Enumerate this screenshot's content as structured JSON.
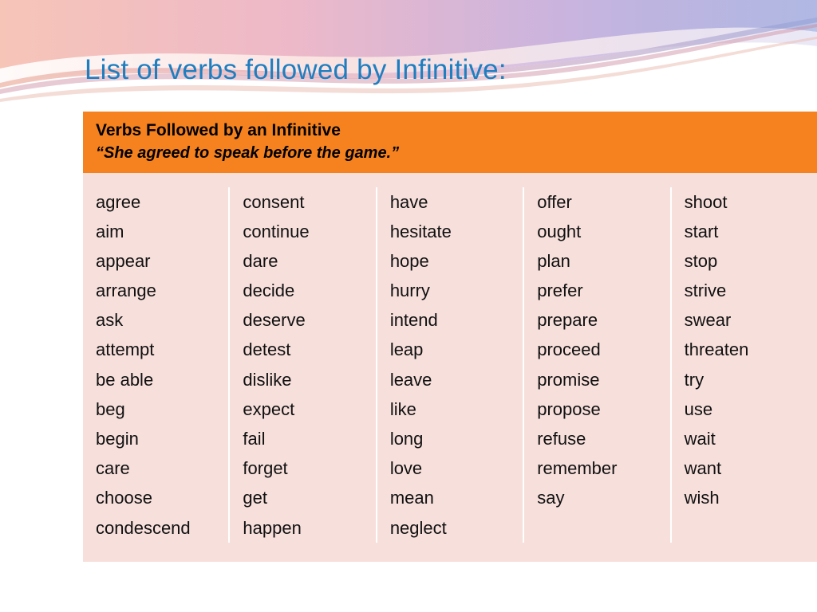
{
  "slide": {
    "title": "List of verbs followed by Infinitive:",
    "table": {
      "header_title": "Verbs Followed by an Infinitive",
      "header_example": "“She agreed to speak before the game.”",
      "columns": [
        [
          "agree",
          "aim",
          "appear",
          "arrange",
          "ask",
          "attempt",
          "be able",
          "beg",
          "begin",
          "care",
          "choose",
          "condescend"
        ],
        [
          "consent",
          "continue",
          "dare",
          "decide",
          "deserve",
          "detest",
          "dislike",
          "expect",
          "fail",
          "forget",
          "get",
          "happen"
        ],
        [
          "have",
          "hesitate",
          "hope",
          "hurry",
          "intend",
          "leap",
          "leave",
          "like",
          "long",
          "love",
          "mean",
          "neglect"
        ],
        [
          "offer",
          "ought",
          "plan",
          "prefer",
          "prepare",
          "proceed",
          "promise",
          "propose",
          "refuse",
          "remember",
          "say"
        ],
        [
          "shoot",
          "start",
          "stop",
          "strive",
          "swear",
          "threaten",
          "try",
          "use",
          "wait",
          "want",
          "wish"
        ]
      ]
    },
    "colors": {
      "title": "#1f7ec0",
      "header_bg": "#f5821f",
      "table_bg": "#f7dfdb",
      "text": "#111111"
    }
  }
}
